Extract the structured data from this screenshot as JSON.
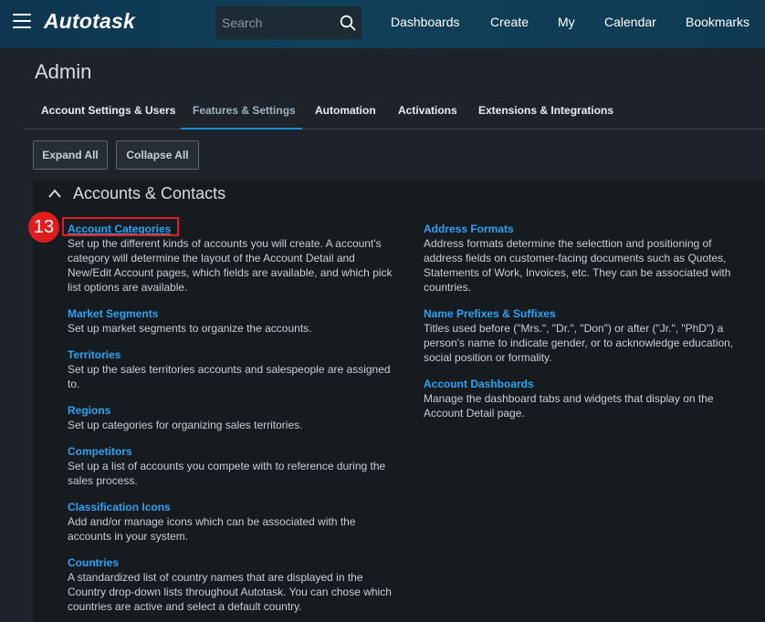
{
  "topbar": {
    "logo": "Autotask",
    "search_placeholder": "Search",
    "nav": [
      "Dashboards",
      "Create",
      "My",
      "Calendar",
      "Bookmarks"
    ]
  },
  "page": {
    "title": "Admin"
  },
  "tabs": [
    {
      "label": "Account Settings & Users"
    },
    {
      "label": "Features & Settings",
      "active": true
    },
    {
      "label": "Automation"
    },
    {
      "label": "Activations"
    },
    {
      "label": "Extensions & Integrations"
    }
  ],
  "buttons": {
    "expand_all": "Expand All",
    "collapse_all": "Collapse All"
  },
  "section": {
    "title": "Accounts & Contacts",
    "left": [
      {
        "title": "Account Categories",
        "desc": "Set up the different kinds of accounts you will create. A account's category will determine the layout of the Account Detail and New/Edit Account pages, which fields are available, and which pick list options are available."
      },
      {
        "title": "Market Segments",
        "desc": "Set up market segments to organize the accounts."
      },
      {
        "title": "Territories",
        "desc": "Set up the sales territories accounts and salespeople are assigned to."
      },
      {
        "title": "Regions",
        "desc": "Set up categories for organizing sales territories."
      },
      {
        "title": "Competitors",
        "desc": "Set up a list of accounts you compete with to reference during the sales process."
      },
      {
        "title": "Classification Icons",
        "desc": "Add and/or manage icons which can be associated with the accounts in your system."
      },
      {
        "title": "Countries",
        "desc": "A standardized list of country names that are displayed in the Country drop-down lists throughout Autotask. You can chose which countries are active and select a default country."
      }
    ],
    "right": [
      {
        "title": "Address Formats",
        "desc": "Address formats determine the selecttion and positioning of address fields on customer-facing documents such as Quotes, Statements of Work, Invoices, etc. They can be associated with countries."
      },
      {
        "title": "Name Prefixes & Suffixes",
        "desc": "Titles used before (\"Mrs.\", \"Dr.\", \"Don\") or after (\"Jr.\", \"PhD\") a person's name to indicate gender, or to acknowledge education, social position or formality."
      },
      {
        "title": "Account Dashboards",
        "desc": "Manage the dashboard tabs and widgets that display on the Account Detail page."
      }
    ]
  },
  "annotation": {
    "step": "13"
  },
  "colors": {
    "accent": "#1a8fd6",
    "link": "#2ea3f2",
    "highlight": "#e02020"
  }
}
